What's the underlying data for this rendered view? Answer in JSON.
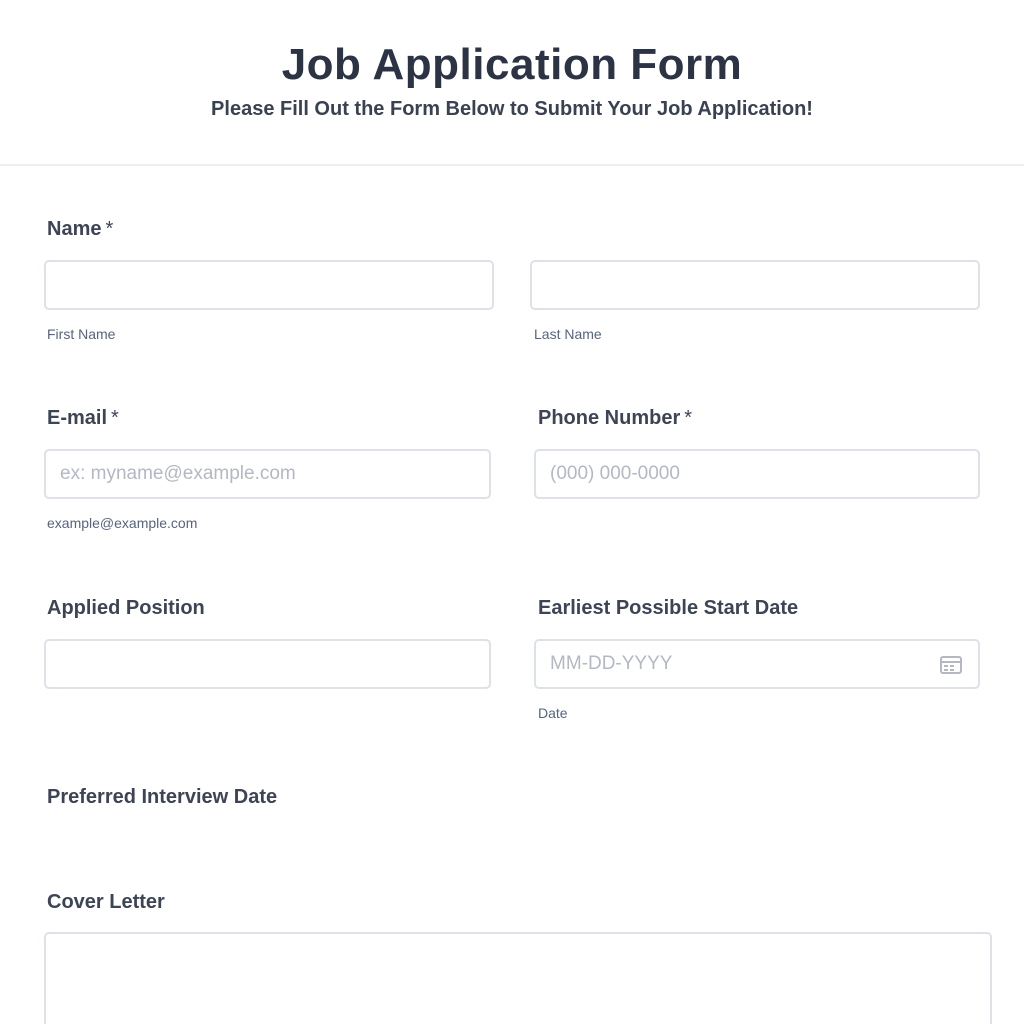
{
  "header": {
    "title": "Job Application Form",
    "subtitle": "Please Fill Out the Form Below to Submit Your Job Application!"
  },
  "fields": {
    "name": {
      "label": "Name",
      "required_mark": "*",
      "first_sublabel": "First Name",
      "last_sublabel": "Last Name"
    },
    "email": {
      "label": "E-mail",
      "required_mark": "*",
      "placeholder": "ex: myname@example.com",
      "sublabel": "example@example.com"
    },
    "phone": {
      "label": "Phone Number",
      "required_mark": "*",
      "placeholder": "(000) 000-0000"
    },
    "position": {
      "label": "Applied Position"
    },
    "start_date": {
      "label": "Earliest Possible Start Date",
      "placeholder": "MM-DD-YYYY",
      "sublabel": "Date",
      "icon": "calendar-icon"
    },
    "interview_date": {
      "label": "Preferred Interview Date"
    },
    "cover_letter": {
      "label": "Cover Letter"
    }
  },
  "colors": {
    "text": "#2c3345",
    "border": "#dfe1e8",
    "placeholder": "#b4b8c3",
    "sublabel": "#57647e"
  }
}
